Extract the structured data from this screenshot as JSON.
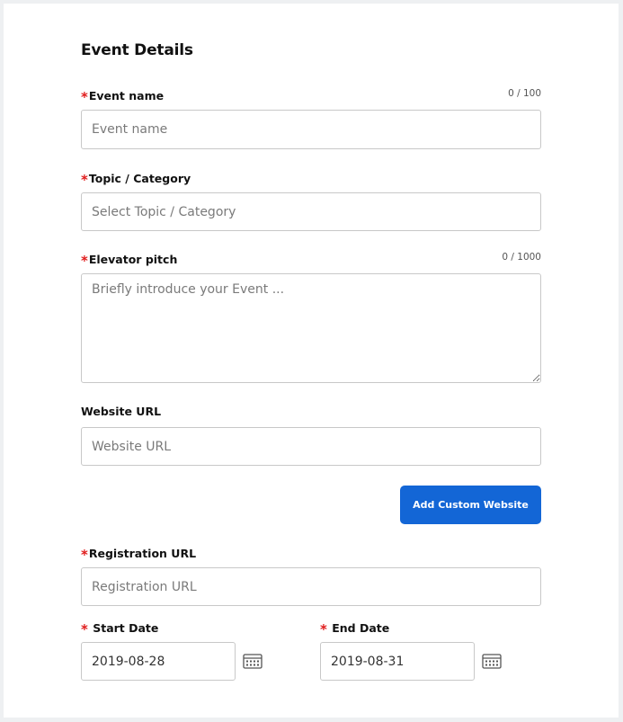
{
  "form": {
    "title": "Event Details",
    "event_name": {
      "label": "Event name",
      "placeholder": "Event name",
      "counter": "0 / 100",
      "required": true
    },
    "topic": {
      "label": "Topic / Category",
      "placeholder": "Select Topic / Category",
      "required": true
    },
    "pitch": {
      "label": "Elevator pitch",
      "placeholder": "Briefly introduce your Event ...",
      "counter": "0 / 1000",
      "required": true
    },
    "website": {
      "label": "Website URL",
      "placeholder": "Website URL",
      "required": false
    },
    "add_custom_website_label": "Add Custom Website",
    "registration": {
      "label": "Registration URL",
      "placeholder": "Registration URL",
      "required": true
    },
    "start_date": {
      "label": "Start Date",
      "value": "2019-08-28",
      "required": true
    },
    "end_date": {
      "label": "End Date",
      "value": "2019-08-31",
      "required": true
    }
  },
  "required_marker": "*",
  "icons": {
    "calendar": "calendar-icon"
  },
  "colors": {
    "accent": "#1366d6",
    "required": "#e01b1b",
    "border": "#c8c8c8"
  }
}
